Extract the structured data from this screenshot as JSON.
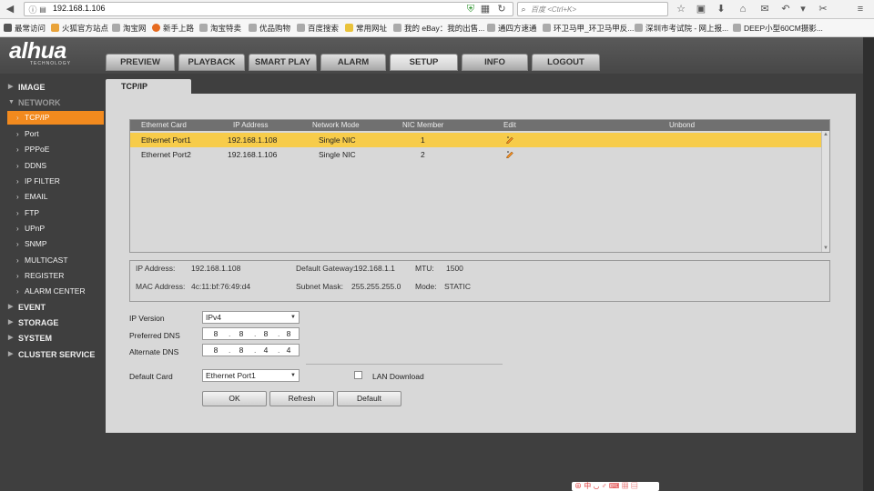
{
  "browser": {
    "url": "192.168.1.106",
    "search_placeholder": "百度 <Ctrl+K>",
    "bookmarks": [
      "最常访问",
      "火狐官方站点",
      "淘宝网",
      "新手上路",
      "淘宝特卖",
      "优品购物",
      "百度搜索",
      "常用网址",
      "我的 eBay：我的出售...",
      "通四方速通",
      "环卫马甲_环卫马甲反...",
      "深圳市考试院 - 网上报...",
      "DEEP小型60CM摄影..."
    ]
  },
  "app": {
    "logo": "alhua",
    "logo_sub": "TECHNOLOGY",
    "top_tabs": [
      "PREVIEW",
      "PLAYBACK",
      "SMART PLAY",
      "ALARM",
      "SETUP",
      "INFO",
      "LOGOUT"
    ],
    "active_tab": "SETUP"
  },
  "sidebar": {
    "sections": [
      "IMAGE",
      "NETWORK",
      "EVENT",
      "STORAGE",
      "SYSTEM",
      "CLUSTER SERVICE"
    ],
    "network_items": [
      "TCP/IP",
      "Port",
      "PPPoE",
      "DDNS",
      "IP FILTER",
      "EMAIL",
      "FTP",
      "UPnP",
      "SNMP",
      "MULTICAST",
      "REGISTER",
      "ALARM CENTER"
    ],
    "active_item": "TCP/IP"
  },
  "page": {
    "tab": "TCP/IP",
    "table": {
      "headers": [
        "Ethernet Card",
        "IP Address",
        "Network Mode",
        "NIC Member",
        "Edit",
        "Unbond"
      ],
      "rows": [
        {
          "card": "Ethernet Port1",
          "ip": "192.168.1.108",
          "mode": "Single NIC",
          "member": "1"
        },
        {
          "card": "Ethernet Port2",
          "ip": "192.168.1.106",
          "mode": "Single NIC",
          "member": "2"
        }
      ],
      "selected_row": 0
    },
    "info": {
      "ip_label": "IP Address:",
      "ip_value": "192.168.1.108",
      "gw_label": "Default Gateway:",
      "gw_value": "192.168.1.1",
      "mtu_label": "MTU:",
      "mtu_value": "1500",
      "mac_label": "MAC Address:",
      "mac_value": "4c:11:bf:76:49:d4",
      "mask_label": "Subnet Mask:",
      "mask_value": "255.255.255.0",
      "mode_label": "Mode:",
      "mode_value": "STATIC"
    },
    "form": {
      "ip_version_label": "IP Version",
      "ip_version_value": "IPv4",
      "preferred_dns_label": "Preferred DNS",
      "preferred_dns": [
        "8",
        "8",
        "8",
        "8"
      ],
      "alternate_dns_label": "Alternate DNS",
      "alternate_dns": [
        "8",
        "8",
        "4",
        "4"
      ],
      "default_card_label": "Default Card",
      "default_card_value": "Ethernet Port1",
      "lan_download_label": "LAN Download"
    },
    "buttons": {
      "ok": "OK",
      "refresh": "Refresh",
      "default": "Default"
    }
  },
  "colors": {
    "accent": "#f28a1e",
    "selected_row": "#f7cc4a",
    "panel": "#d8d8d8",
    "background": "#3f3f3f"
  }
}
